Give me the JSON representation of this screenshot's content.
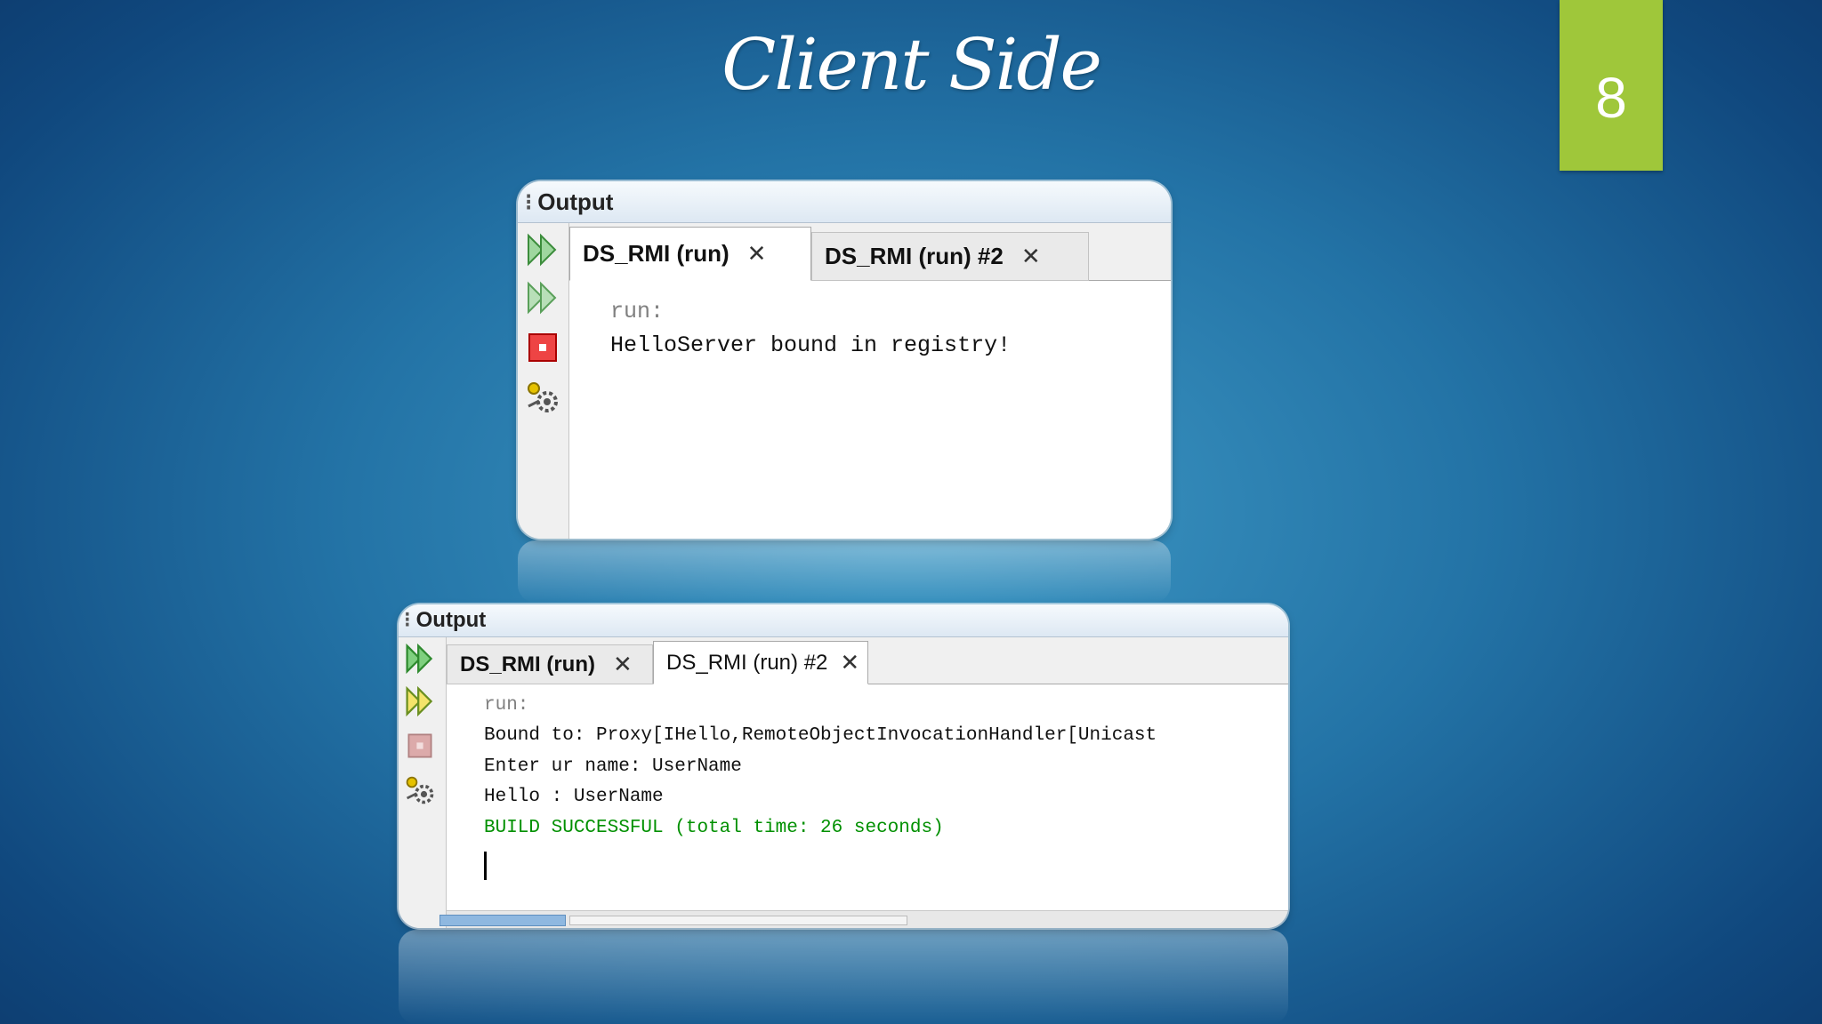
{
  "slide": {
    "title": "Client Side",
    "page_number": "8",
    "accent_color": "#9fc73a"
  },
  "panel_top": {
    "header_title": "Output",
    "toolbar_icons": [
      "rerun-icon",
      "rerun-with-options-icon",
      "stop-icon",
      "settings-icon"
    ],
    "tabs": [
      {
        "label": "DS_RMI (run)",
        "active": true
      },
      {
        "label": "DS_RMI (run) #2",
        "active": false
      }
    ],
    "console": {
      "run_label": "run:",
      "lines": [
        "HelloServer bound in registry!"
      ]
    }
  },
  "panel_bottom": {
    "header_title": "Output",
    "toolbar_icons": [
      "rerun-icon",
      "rerun-with-options-icon",
      "stop-icon",
      "settings-icon"
    ],
    "tabs": [
      {
        "label": "DS_RMI (run)",
        "active": false
      },
      {
        "label": "DS_RMI (run) #2",
        "active": true
      }
    ],
    "console": {
      "run_label": "run:",
      "lines": [
        "Bound to: Proxy[IHello,RemoteObjectInvocationHandler[Unicast",
        "Enter ur name: UserName",
        "Hello : UserName"
      ],
      "build_message": "BUILD SUCCESSFUL (total time: 26 seconds)"
    }
  }
}
